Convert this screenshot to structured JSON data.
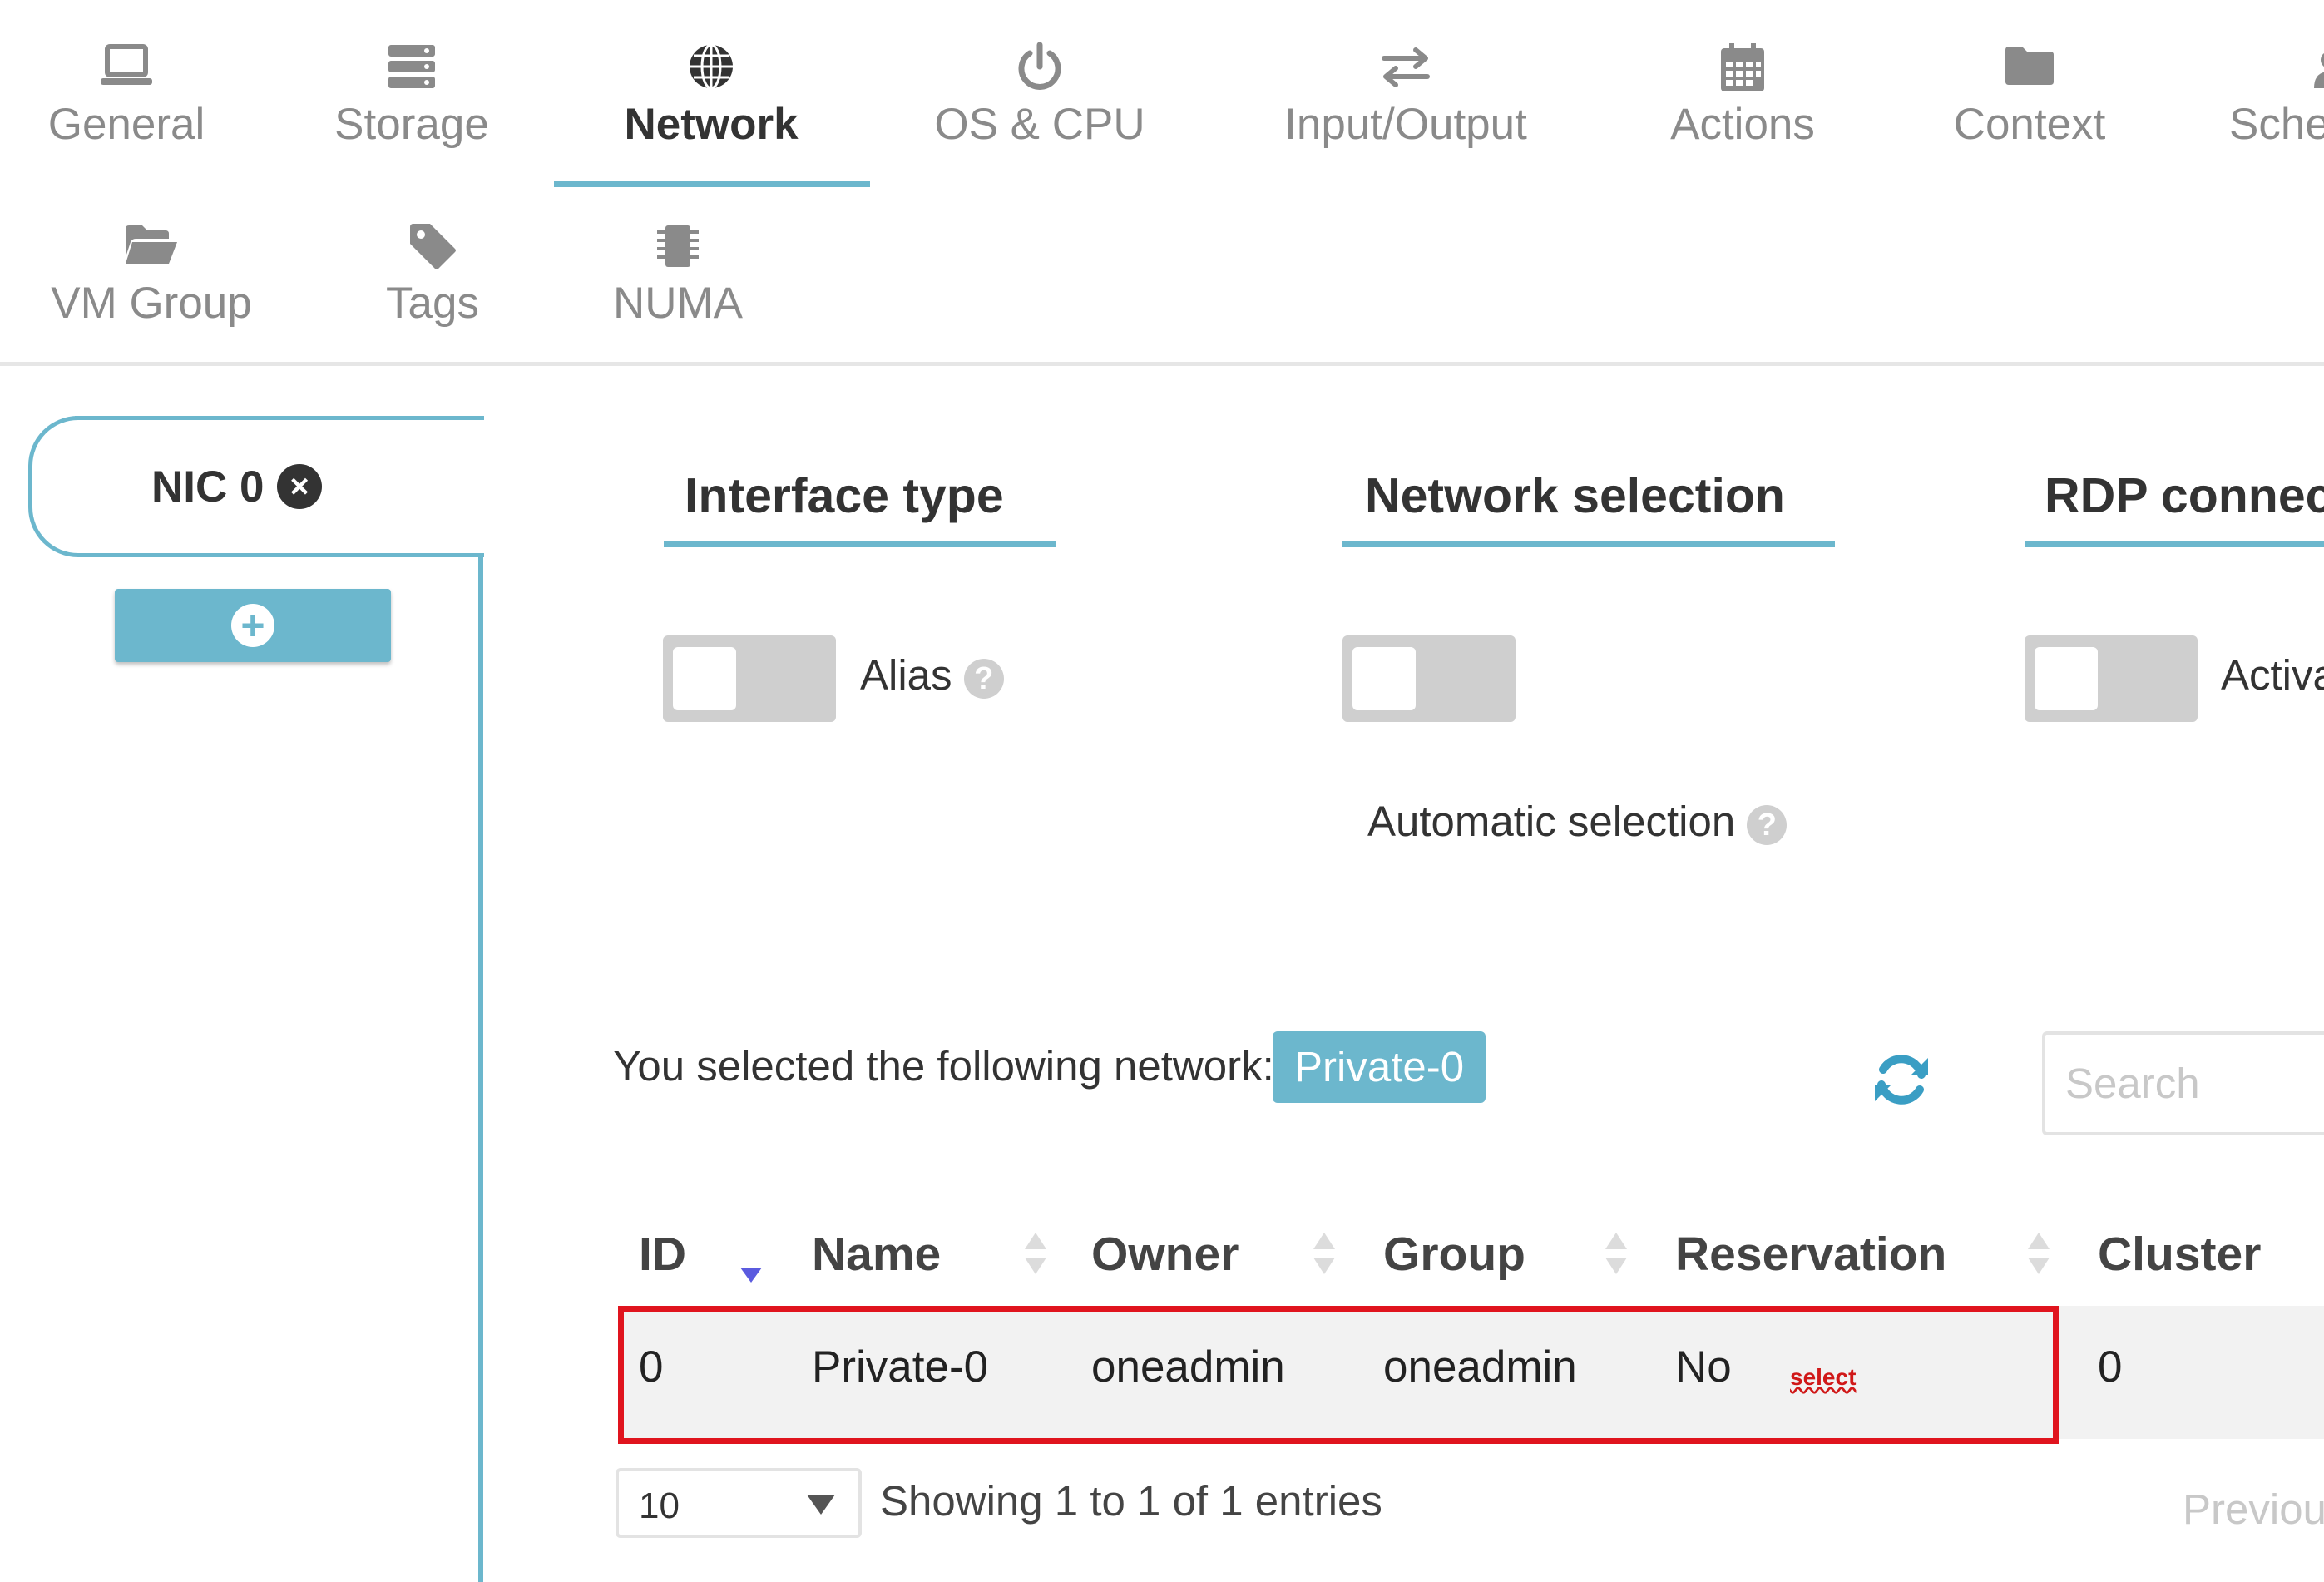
{
  "tabs": [
    {
      "label": "General",
      "icon": "laptop-icon"
    },
    {
      "label": "Storage",
      "icon": "server-icon"
    },
    {
      "label": "Network",
      "icon": "globe-icon",
      "active": true
    },
    {
      "label": "OS & CPU",
      "icon": "power-icon"
    },
    {
      "label": "Input/Output",
      "icon": "exchange-icon"
    },
    {
      "label": "Actions",
      "icon": "calendar-icon"
    },
    {
      "label": "Context",
      "icon": "folder-icon"
    },
    {
      "label": "Sche",
      "icon": "user-icon"
    },
    {
      "label": "VM Group",
      "icon": "folder-open-icon"
    },
    {
      "label": "Tags",
      "icon": "tag-icon"
    },
    {
      "label": "NUMA",
      "icon": "chip-icon"
    }
  ],
  "nic": {
    "tab_label": "NIC 0",
    "close_symbol": "×",
    "add_symbol": "+"
  },
  "sections": {
    "interface_type": "Interface type",
    "network_selection": "Network selection",
    "rdp": "RDP connec"
  },
  "switches": {
    "alias_label": "Alias",
    "automatic_label": "Automatic selection",
    "rdp_label": "Activa"
  },
  "help_symbol": "?",
  "selected": {
    "text": "You selected the following network:",
    "network": "Private-0"
  },
  "search": {
    "placeholder": "Search"
  },
  "table": {
    "columns": [
      "ID",
      "Name",
      "Owner",
      "Group",
      "Reservation",
      "Cluster"
    ],
    "rows": [
      {
        "id": "0",
        "name": "Private-0",
        "owner": "oneadmin",
        "group": "oneadmin",
        "reservation": "No",
        "cluster": "0"
      }
    ],
    "select_annotation": "select"
  },
  "footer": {
    "page_size": "10",
    "showing": "Showing 1 to 1 of 1 entries",
    "previous": "Previou"
  },
  "colors": {
    "accent": "#6cb7cd",
    "highlight": "#e0141e",
    "sort_active": "#5b5bdf"
  }
}
